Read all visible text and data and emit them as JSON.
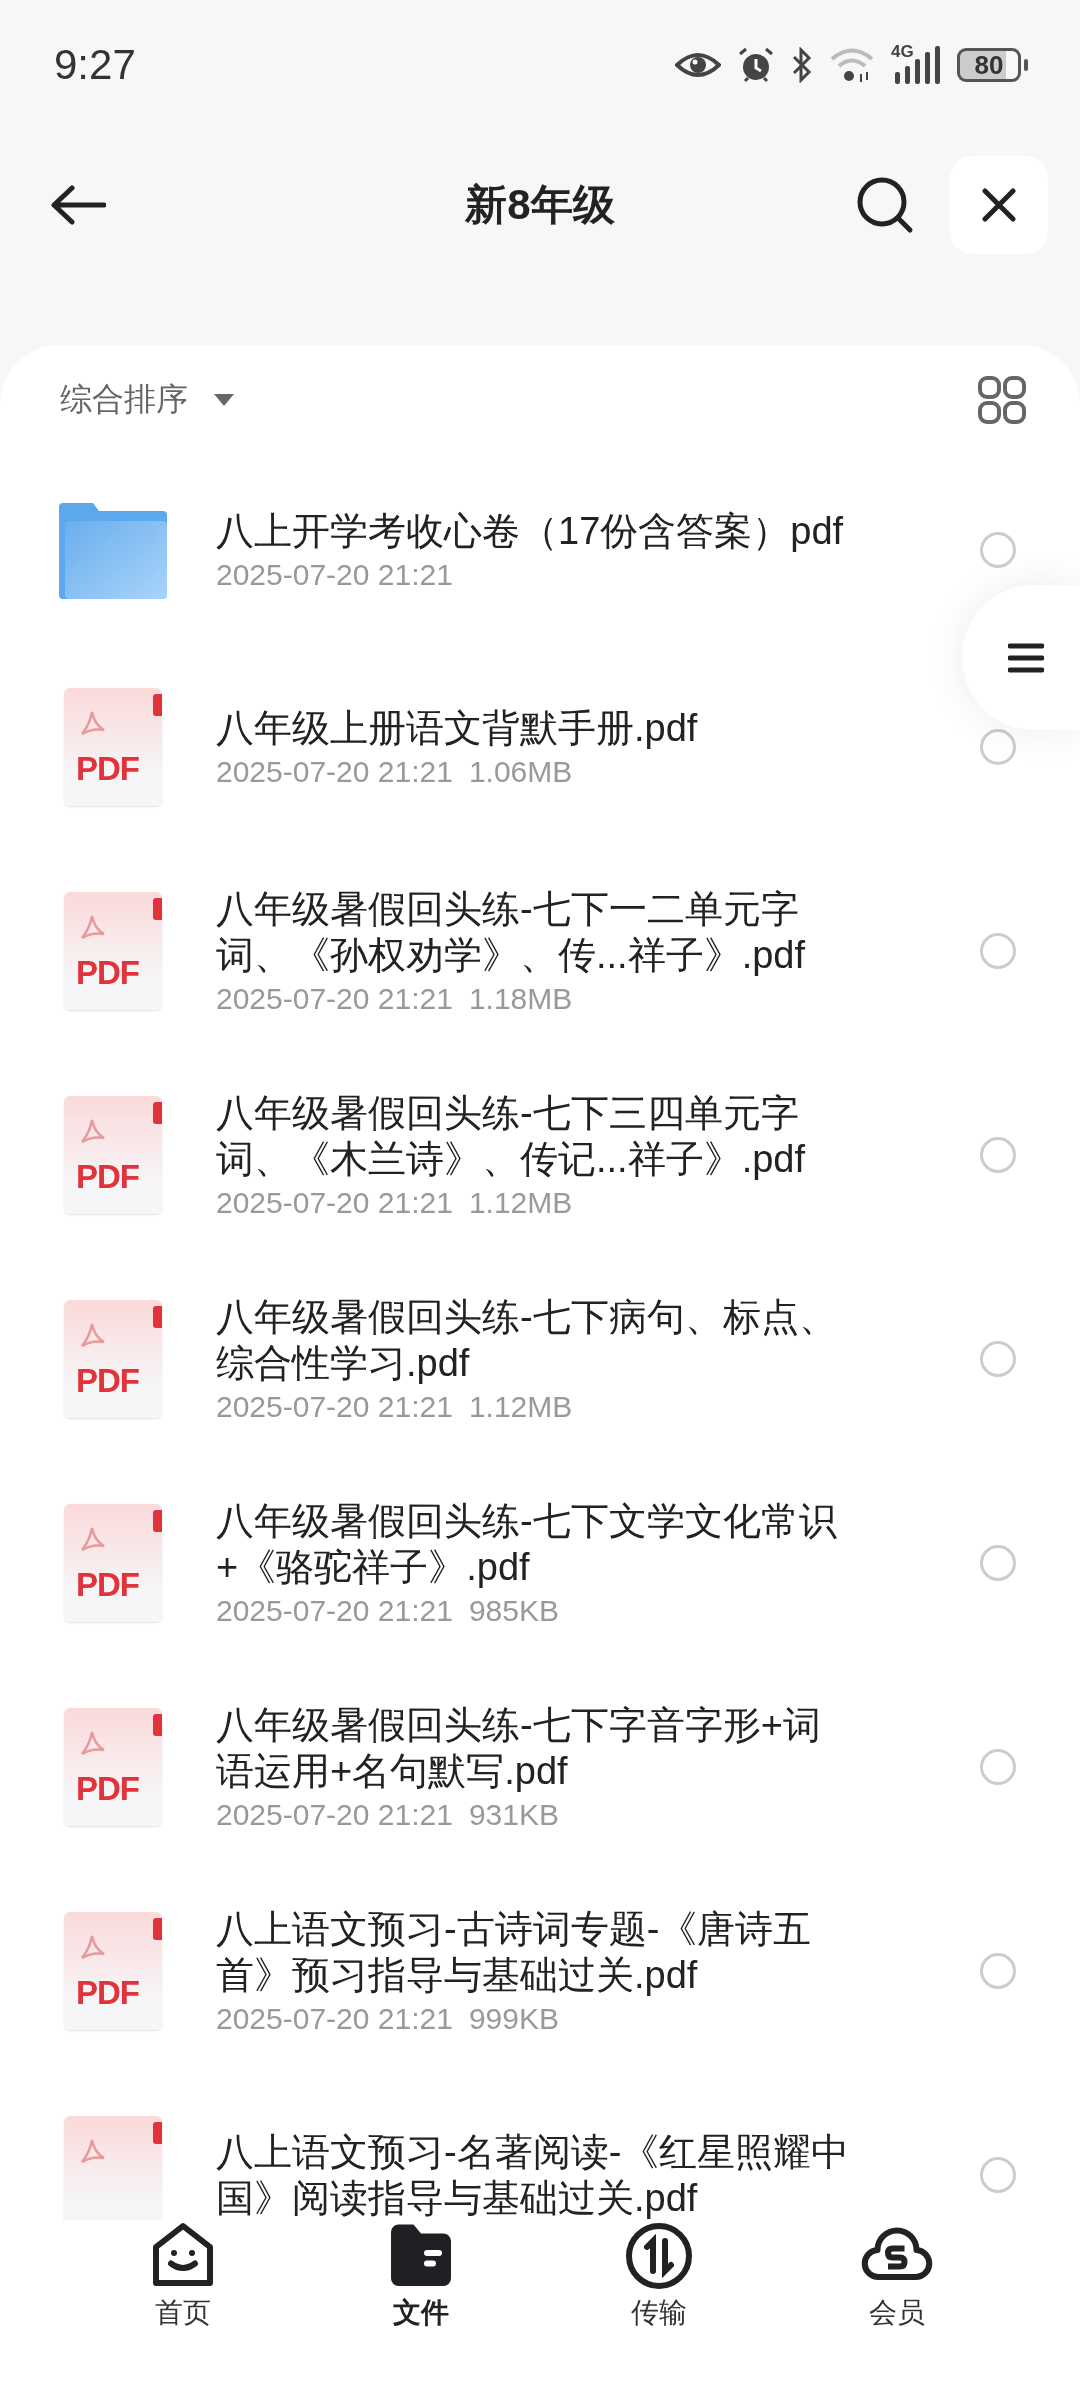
{
  "status_bar": {
    "time": "9:27",
    "battery": "80",
    "network": "4G"
  },
  "header": {
    "title": "新8年级"
  },
  "toolbar": {
    "sort_label": "综合排序"
  },
  "files": [
    {
      "kind": "folder",
      "name": "八上开学考收心卷（17份含答案）pdf",
      "date": "2025-07-20 21:21",
      "selected": false
    },
    {
      "kind": "pdf",
      "badge": "PDF",
      "name": "八年级上册语文背默手册.pdf",
      "date": "2025-07-20 21:21",
      "size": "1.06MB",
      "selected": false
    },
    {
      "kind": "pdf",
      "badge": "PDF",
      "name": "八年级暑假回头练-七下一二单元字词、《孙权劝学》、传...祥子》.pdf",
      "date": "2025-07-20 21:21",
      "size": "1.18MB",
      "selected": false
    },
    {
      "kind": "pdf",
      "badge": "PDF",
      "name": "八年级暑假回头练-七下三四单元字词、《木兰诗》、传记...祥子》.pdf",
      "date": "2025-07-20 21:21",
      "size": "1.12MB",
      "selected": false
    },
    {
      "kind": "pdf",
      "badge": "PDF",
      "name": "八年级暑假回头练-七下病句、标点、综合性学习.pdf",
      "date": "2025-07-20 21:21",
      "size": "1.12MB",
      "selected": false
    },
    {
      "kind": "pdf",
      "badge": "PDF",
      "name": "八年级暑假回头练-七下文学文化常识+《骆驼祥子》.pdf",
      "date": "2025-07-20 21:21",
      "size": "985KB",
      "selected": false
    },
    {
      "kind": "pdf",
      "badge": "PDF",
      "name": "八年级暑假回头练-七下字音字形+词语运用+名句默写.pdf",
      "date": "2025-07-20 21:21",
      "size": "931KB",
      "selected": false
    },
    {
      "kind": "pdf",
      "badge": "PDF",
      "name": "八上语文预习-古诗词专题-《唐诗五首》预习指导与基础过关.pdf",
      "date": "2025-07-20 21:21",
      "size": "999KB",
      "selected": false
    },
    {
      "kind": "pdf",
      "name": "八上语文预习-名著阅读-《红星照耀中国》阅读指导与基础过关.pdf",
      "selected": false
    }
  ],
  "bottom_nav": [
    {
      "kind": "home",
      "label": "首页",
      "selected": false
    },
    {
      "kind": "files",
      "label": "文件",
      "selected": true
    },
    {
      "kind": "transfer",
      "label": "传输",
      "selected": false
    },
    {
      "kind": "vip",
      "label": "会员",
      "selected": false
    }
  ]
}
